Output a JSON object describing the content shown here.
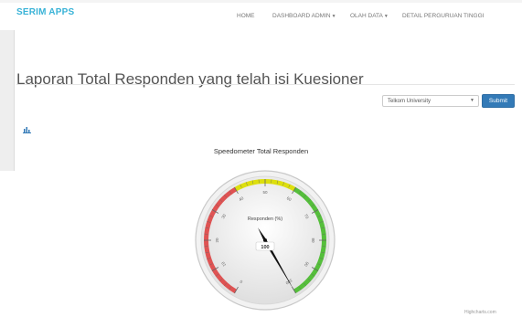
{
  "navbar": {
    "brand": "SERIM APPS",
    "items": [
      {
        "label": "HOME",
        "has_caret": false
      },
      {
        "label": "DASHBOARD ADMIN",
        "has_caret": true
      },
      {
        "label": "OLAH DATA",
        "has_caret": true
      },
      {
        "label": "DETAIL PERGURUAN TINGGI",
        "has_caret": false
      }
    ]
  },
  "page": {
    "title": "Laporan Total Responden yang telah isi Kuesioner"
  },
  "filter": {
    "selected_university": "Telkom University",
    "submit_label": "Submit"
  },
  "chart_icon": "bar-chart-icon",
  "chart_data": {
    "type": "gauge",
    "title": "Speedometer Total Responden",
    "label": "Responden (%)",
    "min": 0,
    "max": 100,
    "value": 100,
    "value_label": "100",
    "ticks": [
      "0",
      "10",
      "20",
      "30",
      "40",
      "50",
      "60",
      "70",
      "80",
      "90",
      "100"
    ],
    "bands": [
      {
        "from": 0,
        "to": 40,
        "color": "#df5353"
      },
      {
        "from": 40,
        "to": 60,
        "color": "#dddf0d"
      },
      {
        "from": 60,
        "to": 100,
        "color": "#55bf3b"
      }
    ]
  },
  "credits": "Highcharts.com"
}
